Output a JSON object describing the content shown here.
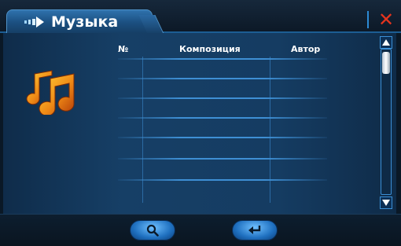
{
  "window": {
    "title": "Музыка",
    "title_icon": "arrow-right-icon",
    "close_icon": "close-icon",
    "close_symbol": "✕"
  },
  "sidebar": {
    "icon": "music-notes-icon"
  },
  "table": {
    "columns": [
      "№",
      "Композиция",
      "Автор"
    ],
    "rows": []
  },
  "scrollbar": {
    "up_icon": "scroll-up-icon",
    "down_icon": "scroll-down-icon"
  },
  "footer": {
    "buttons": [
      {
        "icon": "search-icon"
      },
      {
        "icon": "back-return-icon"
      }
    ]
  },
  "colors": {
    "accent": "#2f72ad",
    "close": "#e5341e",
    "music_icon": "#f08a16"
  }
}
